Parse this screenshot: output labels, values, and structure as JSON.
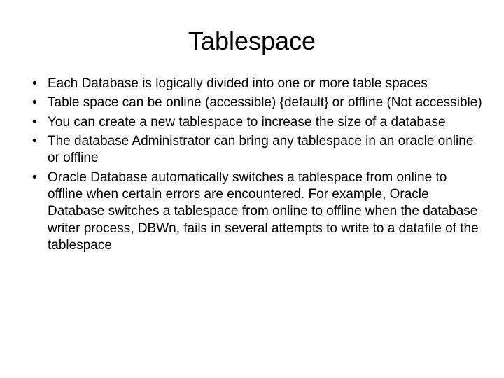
{
  "slide": {
    "title": "Tablespace",
    "bullets": [
      "Each Database is logically divided into one or more table spaces",
      "Table space can be online (accessible) {default}  or offline (Not accessible)",
      "You can create a new tablespace to increase the size of a database",
      "The database Administrator can bring any tablespace in an oracle online or offline",
      "Oracle Database automatically switches a tablespace from online to offline when certain errors are encountered. For example, Oracle Database switches a tablespace from online to offline when the database writer process, DBWn, fails in several attempts to write to a datafile of the tablespace"
    ]
  }
}
